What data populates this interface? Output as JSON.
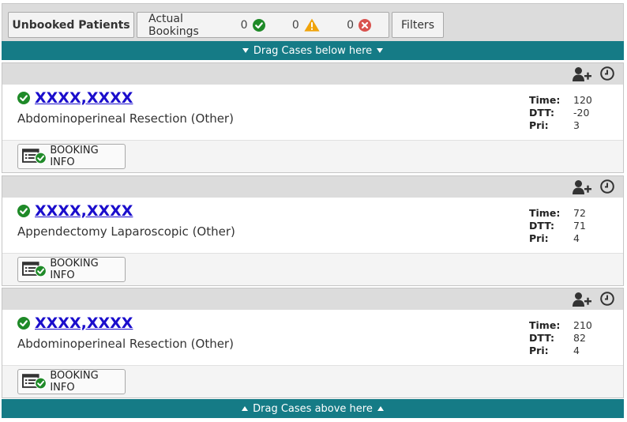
{
  "tabs": {
    "unbooked_label": "Unbooked Patients",
    "actual_label": "Actual Bookings",
    "count_ok": "0",
    "count_warn": "0",
    "count_err": "0",
    "filters_label": "Filters"
  },
  "drag": {
    "below": "Drag Cases below here",
    "above": "Drag Cases above here"
  },
  "colors": {
    "accent_bar": "#157b86",
    "ok": "#1f8a28",
    "warn": "#f0a30a",
    "err": "#d9534f",
    "link": "#1a0dcc"
  },
  "cases": [
    {
      "name": "XXXX,XXXX",
      "procedure": "Abdominoperineal Resection (Other)",
      "time_label": "Time:",
      "time": "120",
      "dtt_label": "DTT:",
      "dtt": "-20",
      "pri_label": "Pri:",
      "pri": "3",
      "booking_label": "BOOKING INFO"
    },
    {
      "name": "XXXX,XXXX",
      "procedure": "Appendectomy Laparoscopic (Other)",
      "time_label": "Time:",
      "time": "72",
      "dtt_label": "DTT:",
      "dtt": "71",
      "pri_label": "Pri:",
      "pri": "4",
      "booking_label": "BOOKING INFO"
    },
    {
      "name": "XXXX,XXXX",
      "procedure": "Abdominoperineal Resection (Other)",
      "time_label": "Time:",
      "time": "210",
      "dtt_label": "DTT:",
      "dtt": "82",
      "pri_label": "Pri:",
      "pri": "4",
      "booking_label": "BOOKING INFO"
    }
  ]
}
